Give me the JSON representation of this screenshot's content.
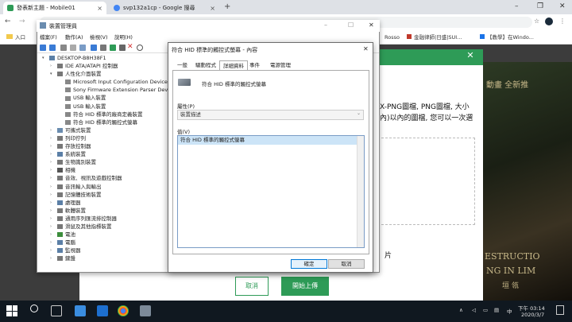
{
  "chrome": {
    "tabs": [
      {
        "title": "發表新主題 - Mobile01",
        "active": true
      },
      {
        "title": "svp132a1cp - Google 搜尋",
        "active": false
      }
    ],
    "new_tab": "+",
    "address": "",
    "bookmarks": [
      "入口",
      "Rosso",
      "金融律師|日盛|SUI...",
      "【教學】在Windo..."
    ]
  },
  "background_page": {
    "text_line1": "X-PNG圖檔, PNG圖檔, 大小",
    "text_line2": "內)以內的圖檔, 您可以一次選",
    "side_text": "片",
    "cancel_label": "取消",
    "upload_label": "開始上傳",
    "art_top": "動畫 全新推",
    "art_mid": "ESTRUCTIO",
    "art_low": "NG IN LIM",
    "art_glyphs": "垣 瓴"
  },
  "device_manager": {
    "title": "裝置管理員",
    "menu": [
      "檔案(F)",
      "動作(A)",
      "檢視(V)",
      "說明(H)"
    ],
    "tree": [
      {
        "label": "DESKTOP-B8H38F1",
        "level": 0,
        "expander": "▾",
        "color": "#5b7fa6"
      },
      {
        "label": "IDE ATA/ATAPI 控制器",
        "level": 1,
        "expander": "›",
        "color": "#777"
      },
      {
        "label": "人性化介面裝置",
        "level": 1,
        "expander": "▾",
        "color": "#777"
      },
      {
        "label": "Microsoft Input Configuration Device",
        "level": 2,
        "expander": "",
        "color": "#888"
      },
      {
        "label": "Sony Firmware Extension Parser Device",
        "level": 2,
        "expander": "",
        "color": "#888"
      },
      {
        "label": "USB 輸入裝置",
        "level": 2,
        "expander": "",
        "color": "#888"
      },
      {
        "label": "USB 輸入裝置",
        "level": 2,
        "expander": "",
        "color": "#888"
      },
      {
        "label": "符合 HID 標準的廠商定義裝置",
        "level": 2,
        "expander": "",
        "color": "#888"
      },
      {
        "label": "符合 HID 標準的觸控式螢幕",
        "level": 2,
        "expander": "",
        "color": "#888"
      },
      {
        "label": "可攜式裝置",
        "level": 1,
        "expander": "›",
        "color": "#6a8caf"
      },
      {
        "label": "列印佇列",
        "level": 1,
        "expander": "›",
        "color": "#777"
      },
      {
        "label": "存放控制器",
        "level": 1,
        "expander": "›",
        "color": "#777"
      },
      {
        "label": "系統裝置",
        "level": 1,
        "expander": "›",
        "color": "#5b7fa6"
      },
      {
        "label": "生物識別裝置",
        "level": 1,
        "expander": "›",
        "color": "#777"
      },
      {
        "label": "相機",
        "level": 1,
        "expander": "›",
        "color": "#555"
      },
      {
        "label": "音效、視訊及遊戲控制器",
        "level": 1,
        "expander": "›",
        "color": "#777"
      },
      {
        "label": "音訊輸入與輸出",
        "level": 1,
        "expander": "›",
        "color": "#777"
      },
      {
        "label": "記憶體技術裝置",
        "level": 1,
        "expander": "›",
        "color": "#777"
      },
      {
        "label": "處理器",
        "level": 1,
        "expander": "›",
        "color": "#5b7fa6"
      },
      {
        "label": "軟體裝置",
        "level": 1,
        "expander": "›",
        "color": "#777"
      },
      {
        "label": "通用序列匯流排控制器",
        "level": 1,
        "expander": "›",
        "color": "#777"
      },
      {
        "label": "滑鼠及其他指標裝置",
        "level": 1,
        "expander": "›",
        "color": "#777"
      },
      {
        "label": "電池",
        "level": 1,
        "expander": "›",
        "color": "#3c8d3c"
      },
      {
        "label": "電腦",
        "level": 1,
        "expander": "›",
        "color": "#5b7fa6"
      },
      {
        "label": "監視器",
        "level": 1,
        "expander": "›",
        "color": "#5b7fa6"
      },
      {
        "label": "鍵盤",
        "level": 1,
        "expander": "›",
        "color": "#777"
      }
    ]
  },
  "properties": {
    "title": "符合 HID 標準的觸控式螢幕 - 內容",
    "tabs": [
      "一般",
      "驅動程式",
      "詳細資料",
      "事件",
      "電源管理"
    ],
    "active_tab": 2,
    "device_name": "符合 HID 標準的觸控式螢幕",
    "property_label": "屬性(P)",
    "property_value": "裝置描述",
    "value_label": "值(V)",
    "value_item": "符合 HID 標準的觸控式螢幕",
    "ok_label": "確定",
    "cancel_label": "取消"
  },
  "taskbar": {
    "time": "下午 03:14",
    "date": "2020/3/7",
    "ime": "中",
    "colors": {
      "accent": "#2e9b57"
    }
  }
}
